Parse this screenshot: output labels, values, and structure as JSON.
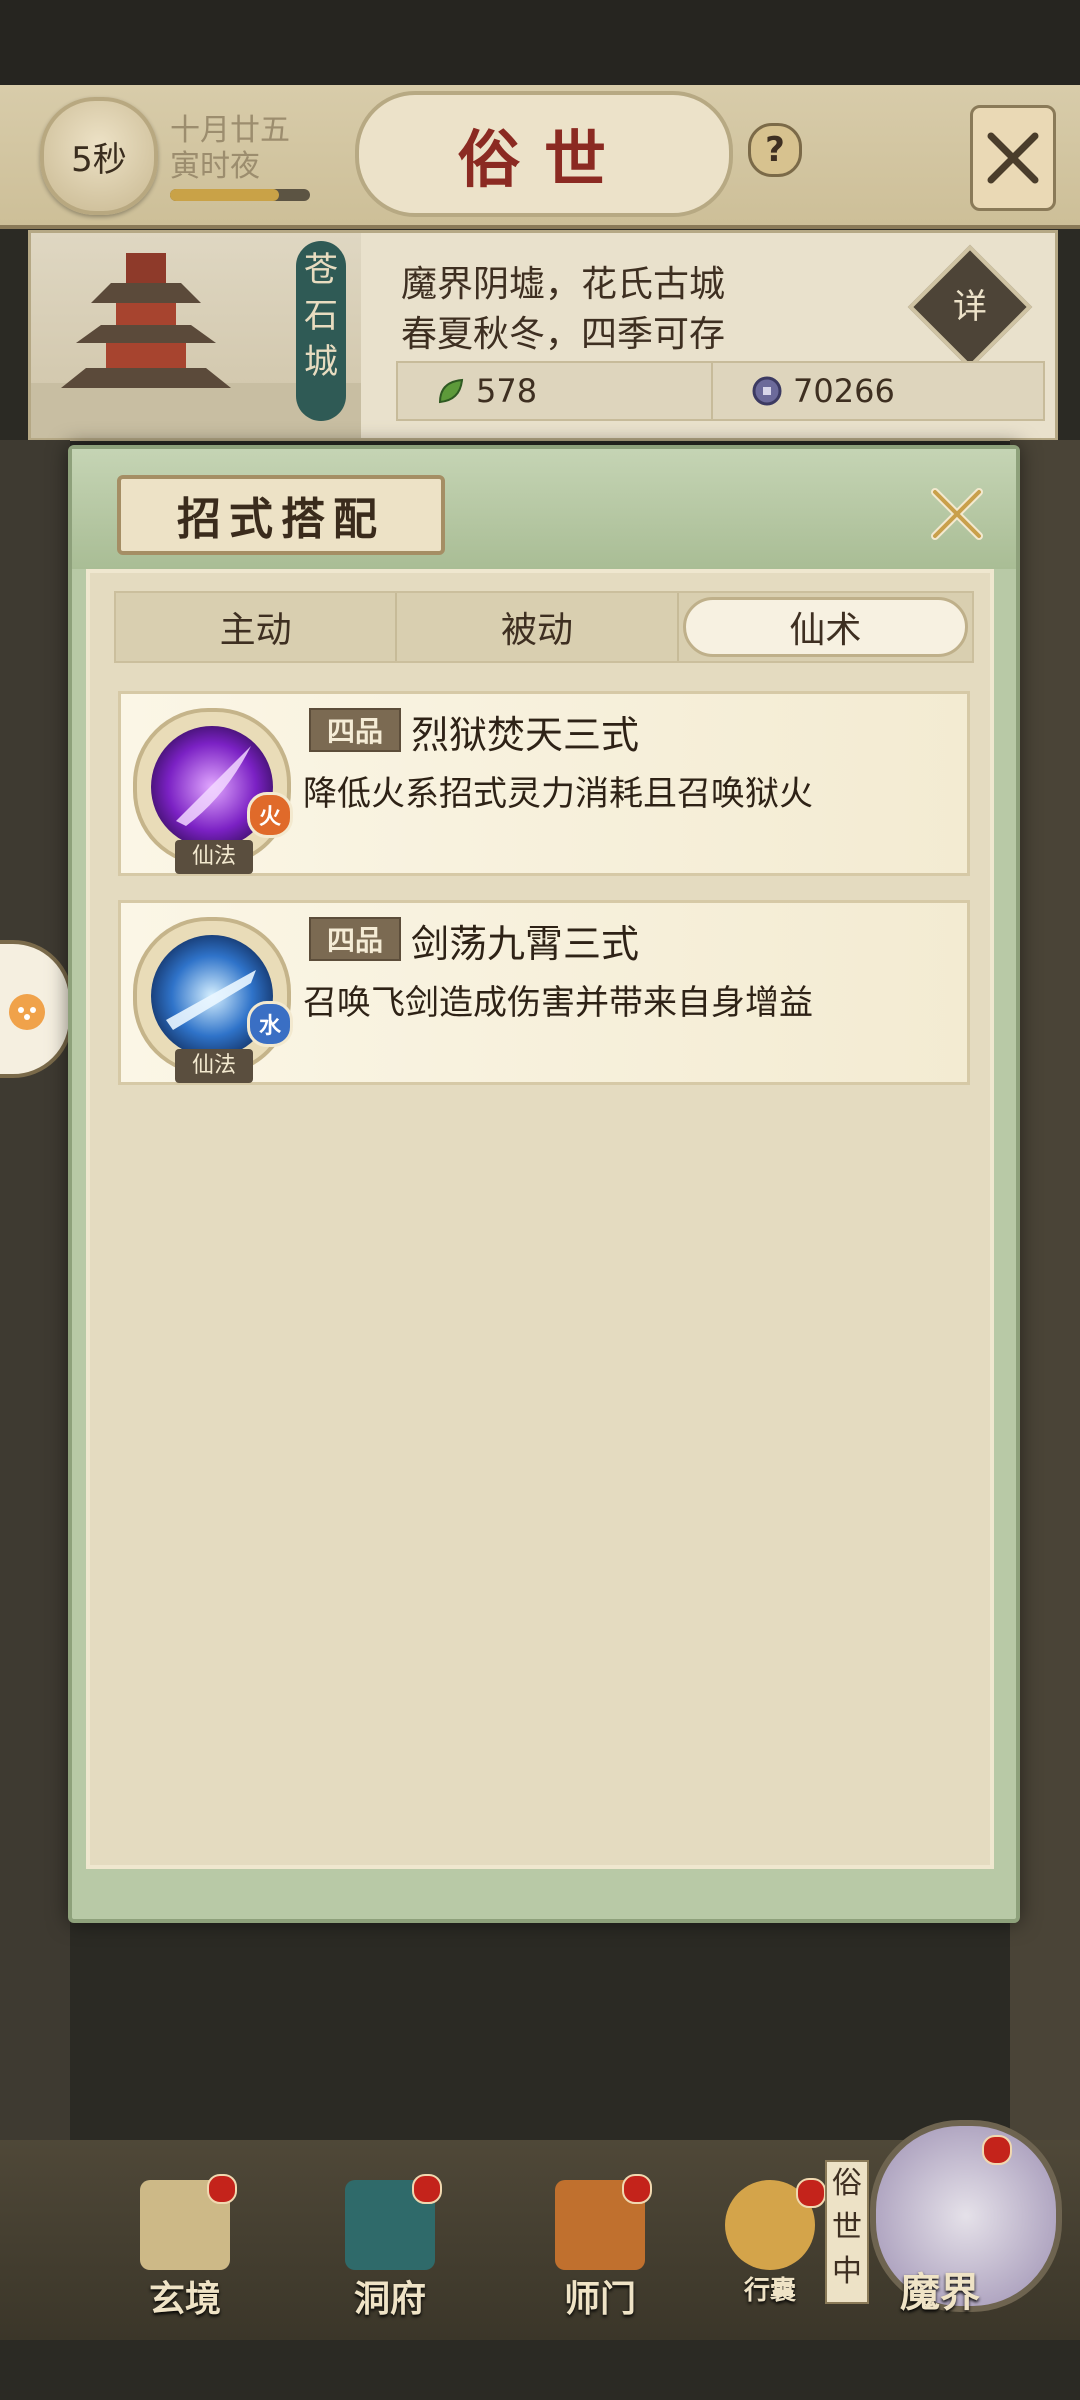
{
  "header": {
    "timer": "5秒",
    "date_line1": "十月廿五",
    "date_line2": "寅时夜",
    "time_progress": 0.78,
    "title": "俗世",
    "help": "?"
  },
  "city": {
    "name": "苍石城",
    "desc_line1": "魔界阴墟，花氏古城",
    "desc_line2": "春夏秋冬，四季可存",
    "detail_label": "详",
    "resource1": "578",
    "resource2": "70266"
  },
  "modal": {
    "title": "招式搭配",
    "tabs": [
      {
        "label": "主动"
      },
      {
        "label": "被动"
      },
      {
        "label": "仙术"
      }
    ],
    "active_tab": "仙术",
    "skills": [
      {
        "grade": "四品",
        "name": "烈狱焚天三式",
        "desc": "降低火系招式灵力消耗且召唤狱火",
        "element": "火",
        "type": "仙法",
        "element_color": "#e06a2a"
      },
      {
        "grade": "四品",
        "name": "剑荡九霄三式",
        "desc": "召唤飞剑造成伤害并带来自身增益",
        "element": "水",
        "type": "仙法",
        "element_color": "#3a6fc4"
      }
    ]
  },
  "nav": {
    "items": [
      {
        "label": "玄境"
      },
      {
        "label": "洞府"
      },
      {
        "label": "师门"
      },
      {
        "label": "行囊"
      },
      {
        "label": "魔界"
      }
    ],
    "vertical_tag": "俗世中"
  }
}
